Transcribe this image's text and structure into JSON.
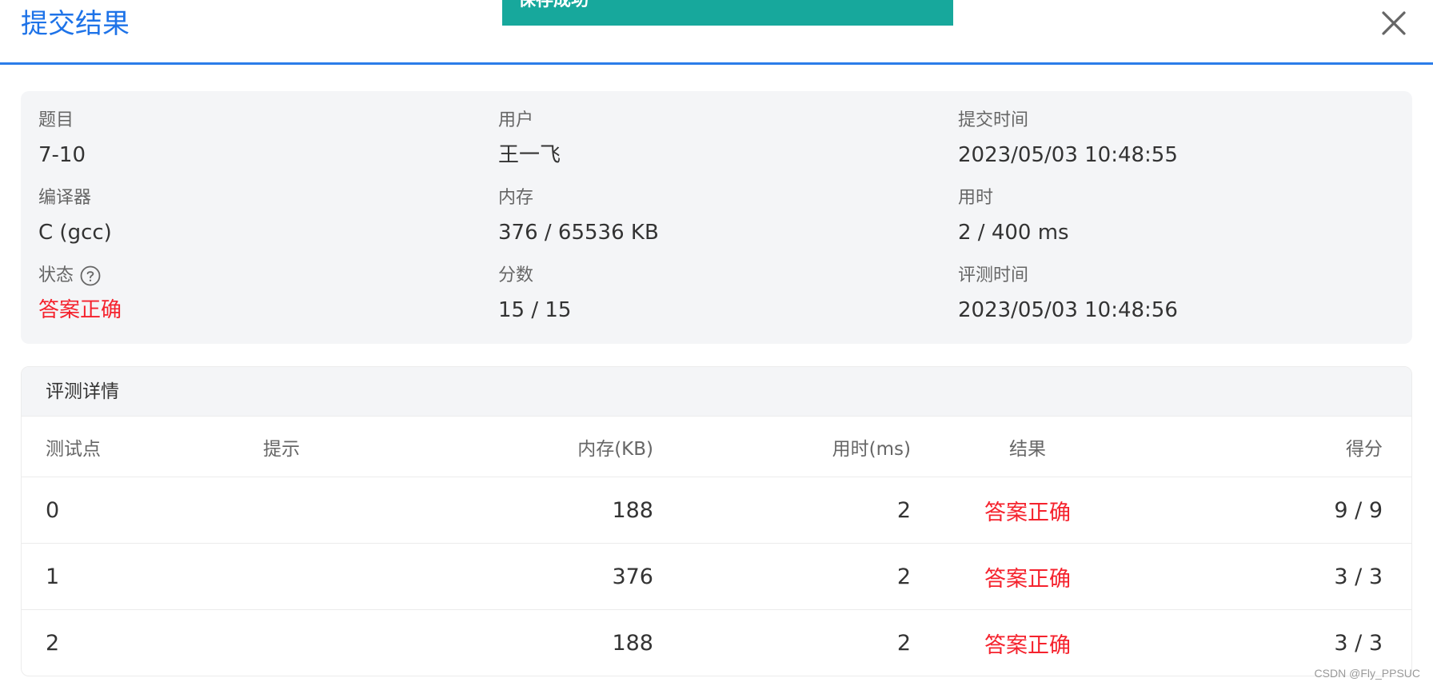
{
  "header": {
    "title": "提交结果",
    "toast": "保存成功"
  },
  "summary": {
    "problem": {
      "label": "题目",
      "value": "7-10"
    },
    "user": {
      "label": "用户",
      "value": "王一飞"
    },
    "submit_time": {
      "label": "提交时间",
      "value": "2023/05/03 10:48:55"
    },
    "compiler": {
      "label": "编译器",
      "value": "C (gcc)"
    },
    "memory": {
      "label": "内存",
      "value": "376 / 65536 KB"
    },
    "time_used": {
      "label": "用时",
      "value": "2 / 400 ms"
    },
    "status": {
      "label": "状态",
      "value": "答案正确"
    },
    "score": {
      "label": "分数",
      "value": "15 / 15"
    },
    "judge_time": {
      "label": "评测时间",
      "value": "2023/05/03 10:48:56"
    }
  },
  "details": {
    "title": "评测详情",
    "columns": {
      "point": "测试点",
      "hint": "提示",
      "memory": "内存(KB)",
      "time": "用时(ms)",
      "result": "结果",
      "score": "得分"
    },
    "rows": [
      {
        "point": "0",
        "hint": "",
        "memory": "188",
        "time": "2",
        "result": "答案正确",
        "score": "9 / 9"
      },
      {
        "point": "1",
        "hint": "",
        "memory": "376",
        "time": "2",
        "result": "答案正确",
        "score": "3 / 3"
      },
      {
        "point": "2",
        "hint": "",
        "memory": "188",
        "time": "2",
        "result": "答案正确",
        "score": "3 / 3"
      }
    ]
  },
  "watermark": "CSDN @Fly_PPSUC",
  "colors": {
    "accent": "#1e73e8",
    "toast": "#17a89c",
    "success_text": "#f5222d",
    "panel_bg": "#f4f5f7"
  },
  "icons": {
    "close": "close-icon",
    "help": "help-circle-icon"
  }
}
